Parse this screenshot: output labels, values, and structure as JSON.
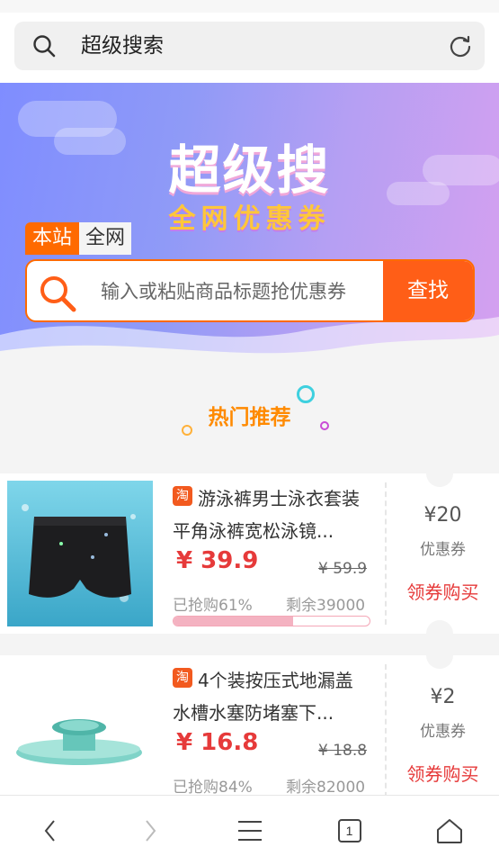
{
  "browser": {
    "search_text": "超级搜索"
  },
  "banner": {
    "title": "超级搜",
    "subtitle": "全网优惠券",
    "scope_tabs": [
      "本站",
      "全网"
    ],
    "search_placeholder": "输入或粘贴商品标题抢优惠券",
    "search_button": "查找"
  },
  "section": {
    "title": "热门推荐"
  },
  "products": [
    {
      "platform_badge": "淘",
      "title": "游泳裤男士泳衣套装平角泳裤宽松泳镜...",
      "price": "¥ 39.9",
      "original_price": "¥ 59.9",
      "sold_text": "已抢购61%",
      "sold_percent": 61,
      "remaining_text": "剩余39000",
      "coupon_value": "¥20",
      "coupon_label": "优惠券",
      "buy_label": "领券购买"
    },
    {
      "platform_badge": "淘",
      "title": "4个装按压式地漏盖水槽水塞防堵塞下...",
      "price": "¥ 16.8",
      "original_price": "¥ 18.8",
      "sold_text": "已抢购84%",
      "sold_percent": 84,
      "remaining_text": "剩余82000",
      "coupon_value": "¥2",
      "coupon_label": "优惠券",
      "buy_label": "领券购买"
    }
  ],
  "nav": {
    "tab_count": "1"
  },
  "colors": {
    "accent": "#ff6a00",
    "price_red": "#e63a3a",
    "hot_orange": "#ff8a00"
  }
}
